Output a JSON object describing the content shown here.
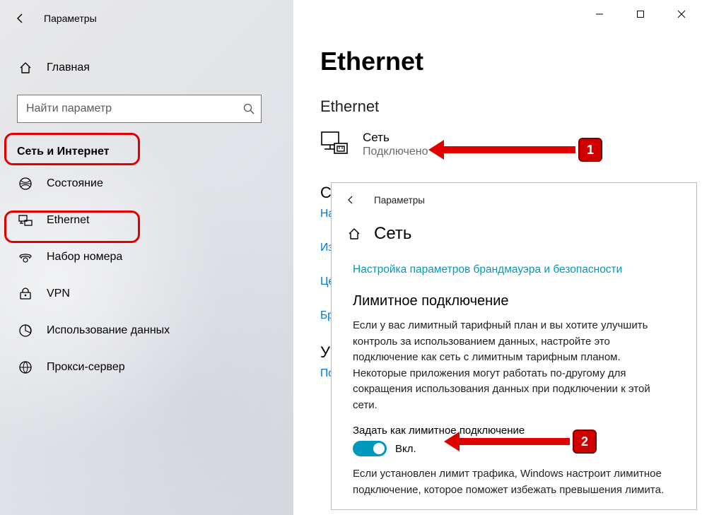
{
  "window": {
    "title": "Параметры"
  },
  "sidebar": {
    "home": "Главная",
    "search_placeholder": "Найти параметр",
    "section": "Сеть и Интернет",
    "items": [
      {
        "icon": "status-icon",
        "label": "Состояние"
      },
      {
        "icon": "ethernet-icon",
        "label": "Ethernet"
      },
      {
        "icon": "dialup-icon",
        "label": "Набор номера"
      },
      {
        "icon": "vpn-icon",
        "label": "VPN"
      },
      {
        "icon": "datausage-icon",
        "label": "Использование данных"
      },
      {
        "icon": "proxy-icon",
        "label": "Прокси-сервер"
      }
    ]
  },
  "main": {
    "title": "Ethernet",
    "subtitle": "Ethernet",
    "network": {
      "name": "Сеть",
      "status": "Подключено"
    },
    "truncated": {
      "h1": "Со",
      "l1": "Наст",
      "l2": "Изме",
      "l3": "Цент",
      "l4": "Бран",
      "h2": "У ва",
      "l5": "Полу"
    }
  },
  "popup": {
    "title": "Параметры",
    "page": "Сеть",
    "link": "Настройка параметров брандмауэра и безопасности",
    "section": "Лимитное подключение",
    "body": "Если у вас лимитный тарифный план и вы хотите улучшить контроль за использованием данных, настройте это подключение как сеть с лимитным тарифным планом. Некоторые приложения могут работать по-другому для сокращения использования данных при подключении к этой сети.",
    "toggle_caption": "Задать как лимитное подключение",
    "toggle_state": "Вкл.",
    "footer": "Если установлен лимит трафика, Windows настроит лимитное подключение, которое поможет избежать превышения лимита."
  },
  "annotations": {
    "badge1": "1",
    "badge2": "2"
  }
}
